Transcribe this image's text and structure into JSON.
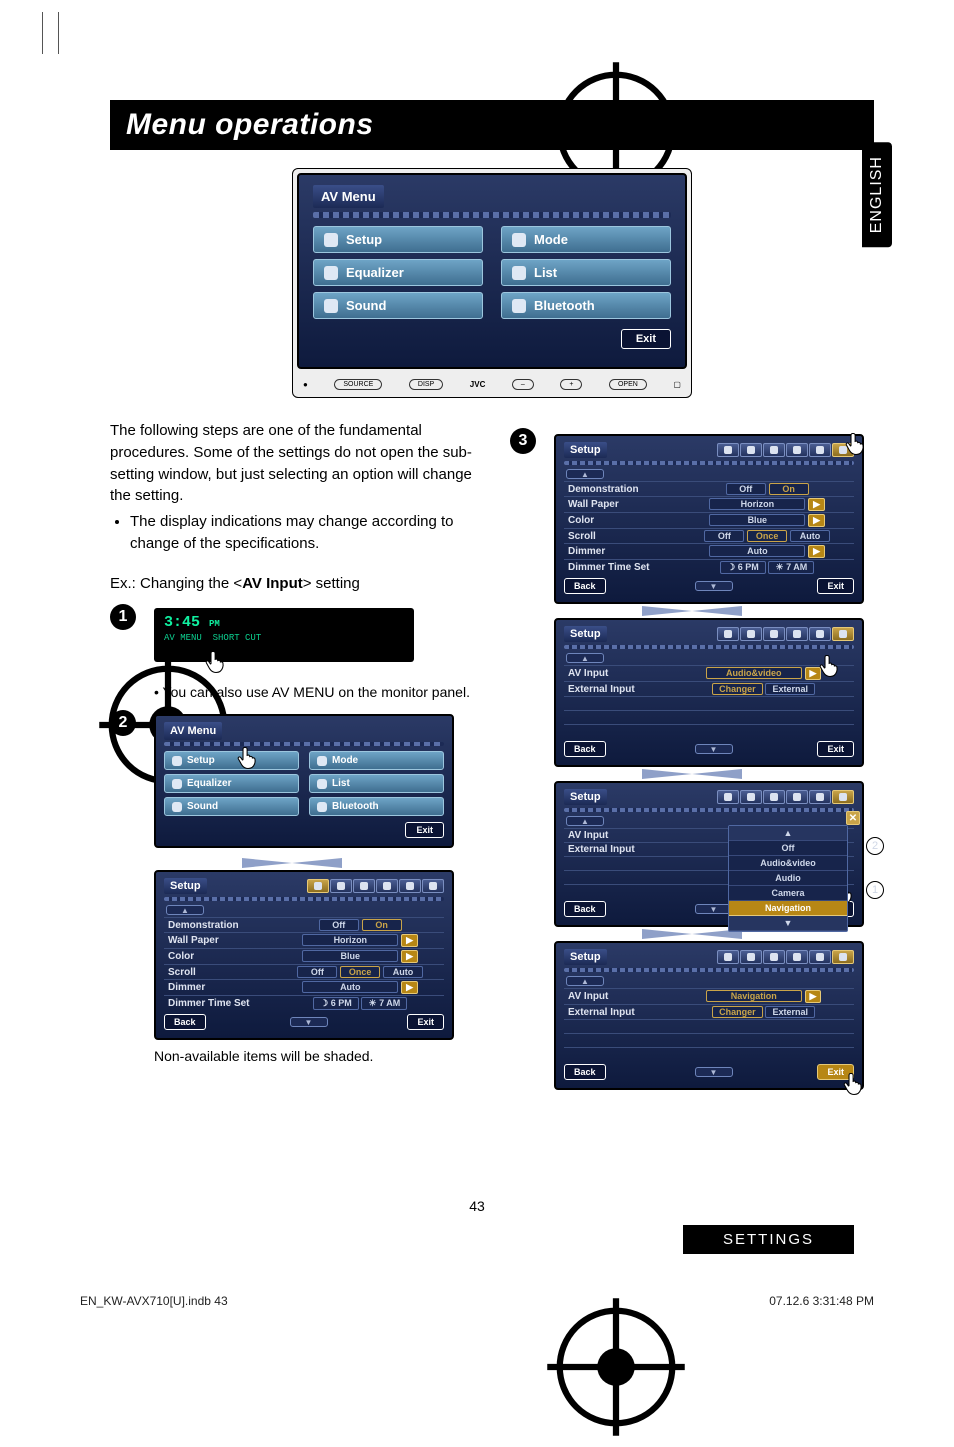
{
  "page": {
    "title": "Menu operations",
    "lang_tab": "ENGLISH",
    "settings_bar": "SETTINGS",
    "page_number": "43",
    "footer_left": "EN_KW-AVX710[U].indb   43",
    "footer_right": "07.12.6   3:31:48 PM"
  },
  "intro": {
    "p1": "The following steps are one of the fundamental procedures. Some of the settings do not open the sub-setting window, but just selecting an option will change the setting.",
    "bullet1": "The display indications may change according to change of the specifications.",
    "ex_label": "Ex.: Changing the <",
    "ex_bold": "AV Input",
    "ex_after": "> setting"
  },
  "av_menu": {
    "title": "AV Menu",
    "items": [
      "Setup",
      "Mode",
      "Equalizer",
      "List",
      "Sound",
      "Bluetooth"
    ],
    "exit": "Exit",
    "device_labels": {
      "source": "SOURCE",
      "disp": "DISP",
      "brand": "JVC",
      "open": "OPEN"
    }
  },
  "step1": {
    "time": "3:45",
    "ampm": "PM",
    "sub1": "AV MENU",
    "sub2": "SHORT CUT"
  },
  "step2": {
    "note": "You can also use AV MENU on the monitor panel.",
    "av_menu_title": "AV Menu",
    "items": [
      "Setup",
      "Mode",
      "Equalizer",
      "List",
      "Sound",
      "Bluetooth"
    ],
    "exit": "Exit",
    "setup": {
      "label": "Setup",
      "rows": [
        {
          "name": "Demonstration",
          "opts": [
            "Off",
            "On"
          ],
          "sel": 1
        },
        {
          "name": "Wall Paper",
          "opts": [
            "Horizon"
          ],
          "arrow": true
        },
        {
          "name": "Color",
          "opts": [
            "Blue"
          ],
          "arrow": true
        },
        {
          "name": "Scroll",
          "opts": [
            "Off",
            "Once",
            "Auto"
          ],
          "sel": 1
        },
        {
          "name": "Dimmer",
          "opts": [
            "Auto"
          ],
          "arrow": true
        },
        {
          "name": "Dimmer Time Set",
          "opts": [
            "6 PM",
            "7 AM"
          ],
          "icons": true
        }
      ],
      "back": "Back",
      "exit": "Exit",
      "non_available": "Non-available items will be shaded."
    }
  },
  "step3": {
    "screens": [
      {
        "label": "Setup",
        "rows": [
          {
            "name": "Demonstration",
            "opts": [
              "Off",
              "On"
            ],
            "sel": 1
          },
          {
            "name": "Wall Paper",
            "opts": [
              "Horizon"
            ],
            "arrow": true
          },
          {
            "name": "Color",
            "opts": [
              "Blue"
            ],
            "arrow": true
          },
          {
            "name": "Scroll",
            "opts": [
              "Off",
              "Once",
              "Auto"
            ],
            "sel": 1
          },
          {
            "name": "Dimmer",
            "opts": [
              "Auto"
            ],
            "arrow": true
          },
          {
            "name": "Dimmer Time Set",
            "opts": [
              "6 PM",
              "7 AM"
            ],
            "icons": true
          }
        ],
        "back": "Back",
        "exit": "Exit",
        "hand": true,
        "pill_sel": 5
      },
      {
        "label": "Setup",
        "rows": [
          {
            "name": "AV Input",
            "opts": [
              "Audio&video"
            ],
            "arrow": true,
            "hand": true
          },
          {
            "name": "External Input",
            "opts": [
              "Changer",
              "External"
            ],
            "sel": 0
          }
        ],
        "back": "Back",
        "exit": "Exit",
        "pill_sel": 5
      },
      {
        "label": "Setup",
        "rows": [
          {
            "name": "AV Input",
            "dropdown": [
              "Off",
              "Audio&video",
              "Audio",
              "Camera",
              "Navigation"
            ]
          },
          {
            "name": "External Input"
          }
        ],
        "back": "Back",
        "exit": "Exit",
        "badge1": "1",
        "badge2": "2",
        "close_x": true,
        "pill_sel": 5
      },
      {
        "label": "Setup",
        "rows": [
          {
            "name": "AV Input",
            "opts": [
              "Navigation"
            ],
            "arrow": true
          },
          {
            "name": "External Input",
            "opts": [
              "Changer",
              "External"
            ],
            "sel": 0
          }
        ],
        "back": "Back",
        "exit": "Exit",
        "hand_exit": true,
        "pill_sel": 5
      }
    ]
  }
}
